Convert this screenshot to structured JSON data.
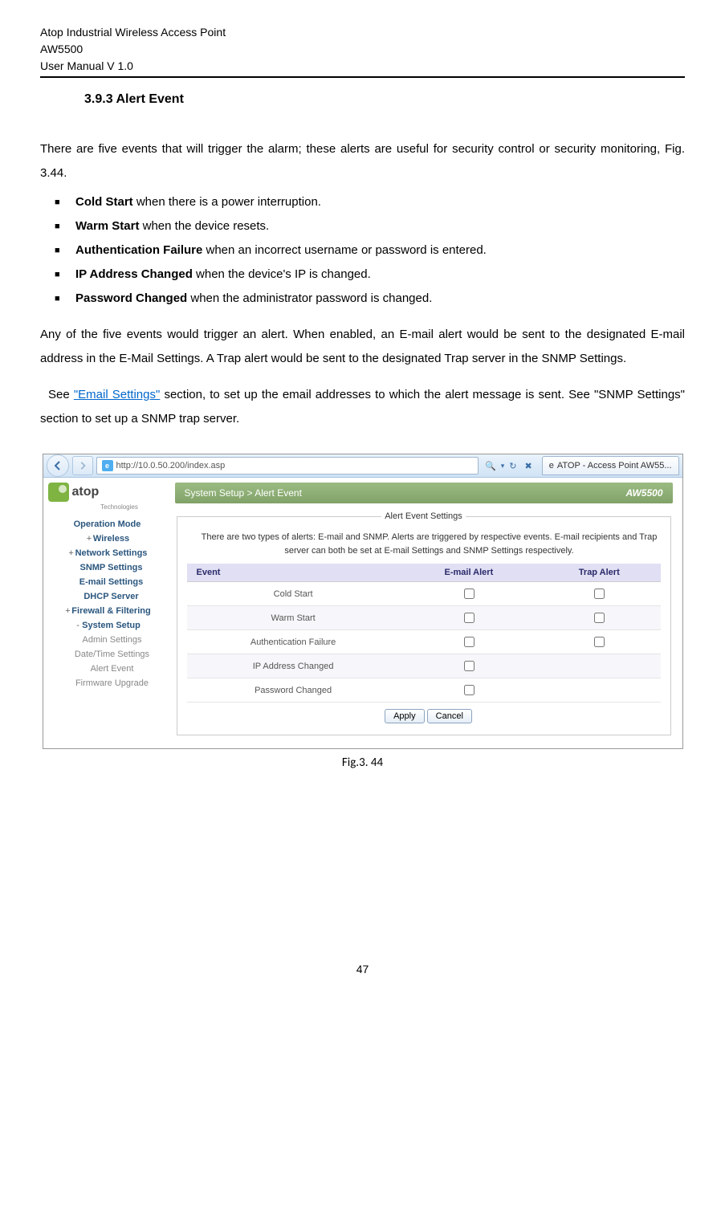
{
  "header": {
    "line1": "Atop Industrial Wireless Access Point",
    "line2": "AW5500",
    "line3": "User Manual V 1.0"
  },
  "section": {
    "heading": "3.9.3 Alert Event",
    "intro": "There are five events that will trigger the alarm; these alerts are useful for security control or security monitoring, Fig. 3.44.",
    "bullets": [
      {
        "strong": "Cold Start",
        "rest": " when there is a power interruption."
      },
      {
        "strong": "Warm Start",
        "rest": " when the device resets."
      },
      {
        "strong": "Authentication Failure",
        "rest": " when an incorrect username or password is entered."
      },
      {
        "strong": "IP Address Changed",
        "rest": " when the device's IP is changed."
      },
      {
        "strong": "Password Changed",
        "rest": " when the administrator password is changed."
      }
    ],
    "para2": "Any of the five events would trigger an alert.   When enabled, an E-mail alert would be sent to the designated E-mail address in the E-Mail Settings. A Trap alert would be sent to the designated Trap server in the SNMP Settings.",
    "para3_pre": "  See ",
    "para3_link": "\"Email Settings\"",
    "para3_post": " section, to set up the email addresses to which the alert message is sent. See \"SNMP Settings\" section to set up a SNMP trap server."
  },
  "browser": {
    "url": "http://10.0.50.200/index.asp",
    "tab_title": "ATOP - Access Point AW55..."
  },
  "app": {
    "logo_main": "atop",
    "logo_sub": "Technologies",
    "breadcrumb": "System Setup > Alert Event",
    "model": "AW5500",
    "menu": [
      {
        "label": "Operation Mode",
        "type": "item"
      },
      {
        "label": "Wireless",
        "type": "exp",
        "sym": "+ "
      },
      {
        "label": "Network Settings",
        "type": "exp",
        "sym": "+ "
      },
      {
        "label": "SNMP Settings",
        "type": "item-indent"
      },
      {
        "label": "E-mail Settings",
        "type": "item-indent"
      },
      {
        "label": "DHCP Server",
        "type": "item-indent"
      },
      {
        "label": "Firewall & Filtering",
        "type": "exp",
        "sym": "+ "
      },
      {
        "label": "System Setup",
        "type": "exp",
        "sym": "- "
      },
      {
        "label": "Admin Settings",
        "type": "sub"
      },
      {
        "label": "Date/Time Settings",
        "type": "sub"
      },
      {
        "label": "Alert Event",
        "type": "sub"
      },
      {
        "label": "Firmware Upgrade",
        "type": "sub"
      }
    ],
    "fieldset_legend": "Alert Event Settings",
    "fieldset_desc": "There are two types of alerts: E-mail and SNMP. Alerts are triggered by respective events. E-mail recipients and Trap server can both be set at E-mail Settings and SNMP Settings respectively.",
    "table": {
      "headers": {
        "event": "Event",
        "email": "E-mail Alert",
        "trap": "Trap Alert"
      },
      "rows": [
        {
          "event": "Cold Start",
          "email": true,
          "trap": true
        },
        {
          "event": "Warm Start",
          "email": true,
          "trap": true
        },
        {
          "event": "Authentication Failure",
          "email": true,
          "trap": true
        },
        {
          "event": "IP Address Changed",
          "email": true,
          "trap": false
        },
        {
          "event": "Password Changed",
          "email": true,
          "trap": false
        }
      ]
    },
    "buttons": {
      "apply": "Apply",
      "cancel": "Cancel"
    }
  },
  "fig_caption": "Fig.3. 44",
  "page_number": "47"
}
